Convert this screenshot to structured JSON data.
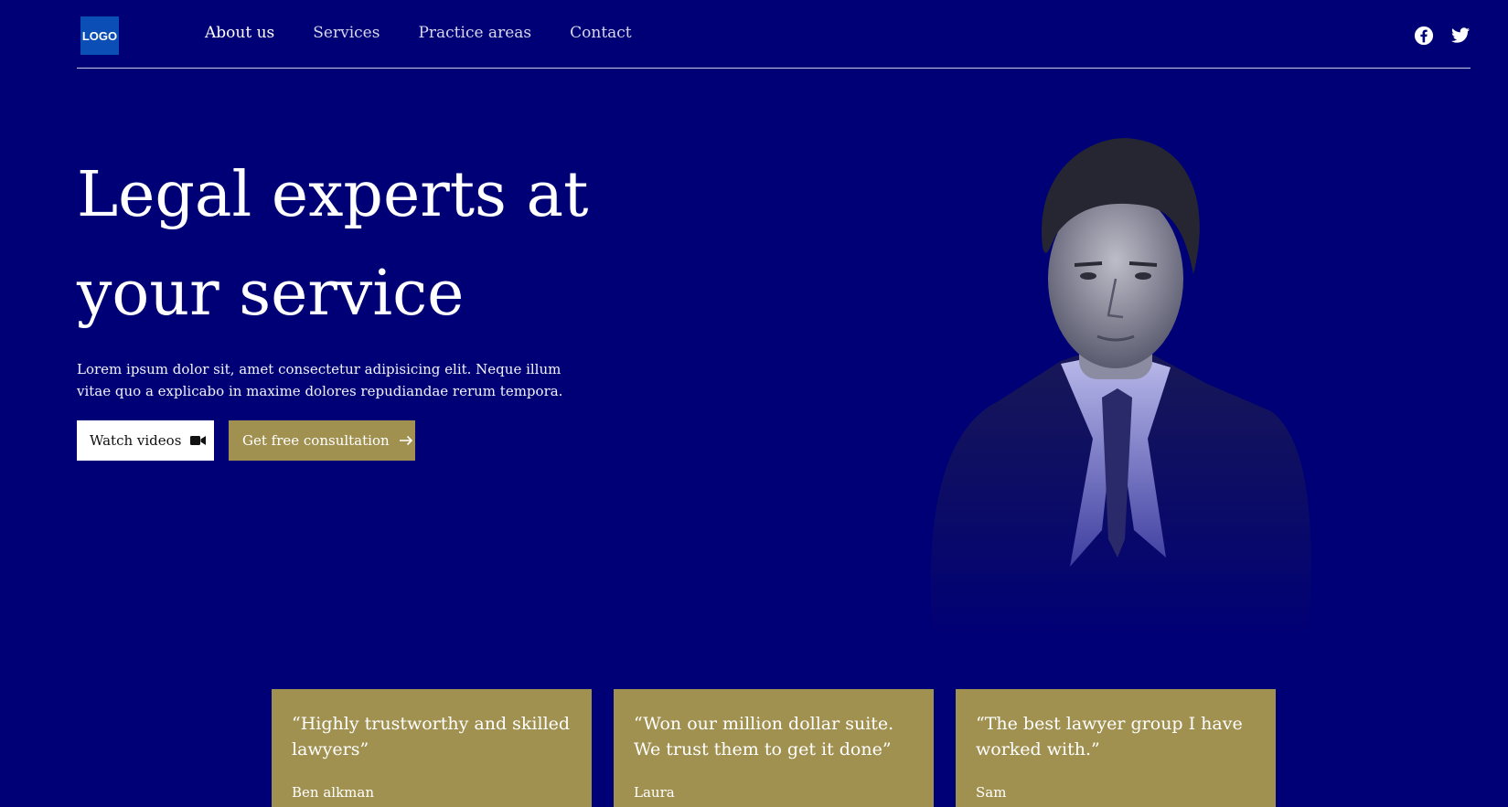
{
  "header": {
    "logo_text": "LOGO",
    "nav": [
      "About us",
      "Services",
      "Practice areas",
      "Contact"
    ],
    "social": [
      "facebook-icon",
      "twitter-icon"
    ]
  },
  "hero": {
    "title_line1": "Legal experts at",
    "title_line2": "your service",
    "description": "Lorem ipsum dolor sit, amet consectetur adipisicing elit. Neque illum vitae quo a explicabo in maxime dolores repudiandae rerum tempora.",
    "watch_label": "Watch videos",
    "consult_label": "Get free consultation"
  },
  "testimonials": [
    {
      "quote": "“Highly trustworthy and skilled lawyers”",
      "author": "Ben alkman"
    },
    {
      "quote": "“Won our million dollar suite. We trust them to get it done”",
      "author": "Laura"
    },
    {
      "quote": "“The best lawyer group I have worked with.”",
      "author": "Sam"
    }
  ],
  "colors": {
    "background": "#000076",
    "accent_gold": "#a19151",
    "logo_blue": "#0b4fb6"
  }
}
